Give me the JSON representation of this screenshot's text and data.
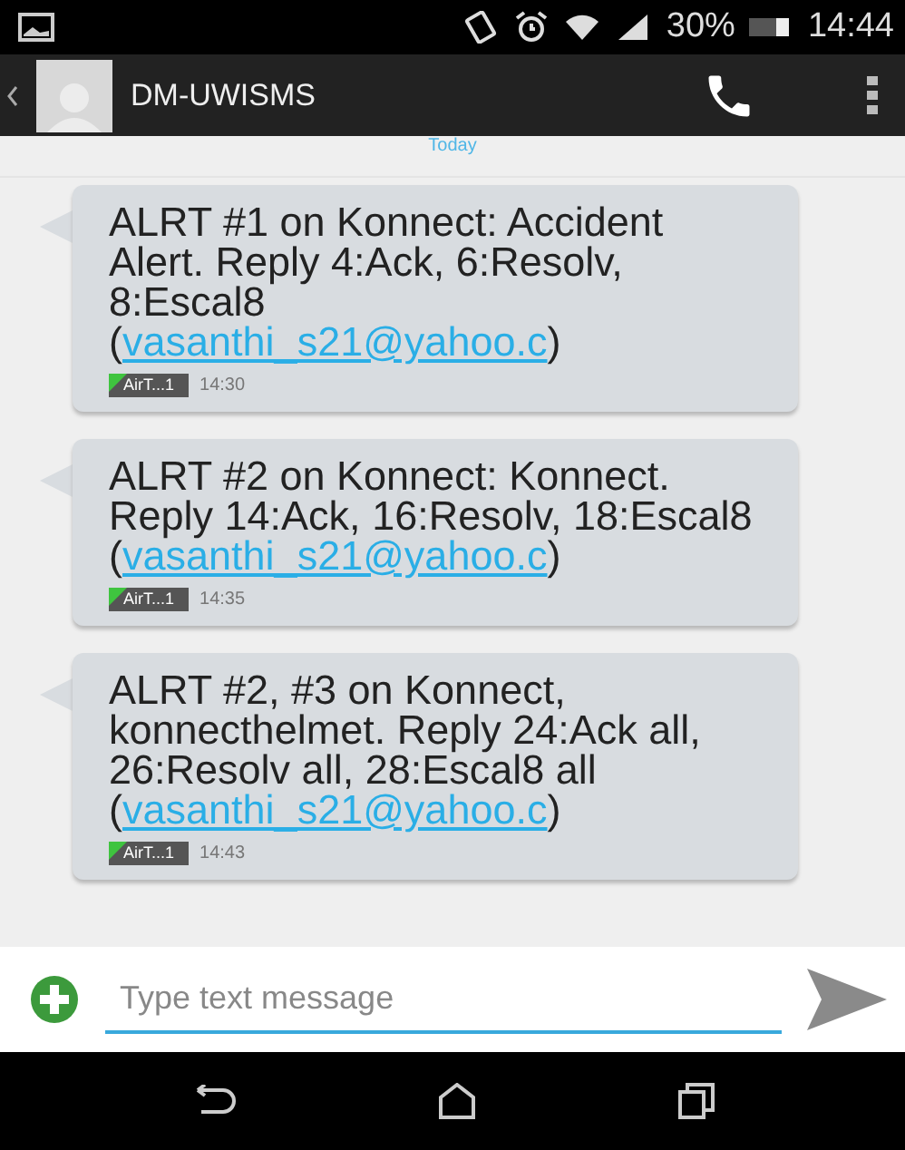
{
  "status_bar": {
    "battery": "30%",
    "time": "14:44"
  },
  "header": {
    "title": "DM-UWISMS"
  },
  "date_divider": "Today",
  "messages": [
    {
      "text": "ALRT #1 on Konnect: Accident Alert. Reply 4:Ack, 6:Resolv, 8:Escal8",
      "before_link": "(",
      "link": "vasanthi_s21@yahoo.c",
      "after_link": ")",
      "sim": "AirT...1",
      "time": "14:30"
    },
    {
      "text": "ALRT #2 on Konnect: Konnect. Reply 14:Ack, 16:Resolv, 18:Escal8",
      "before_link": "(",
      "link": "vasanthi_s21@yahoo.c",
      "after_link": ")",
      "sim": "AirT...1",
      "time": "14:35"
    },
    {
      "text": "ALRT #2, #3 on Konnect, konnecthelmet. Reply 24:Ack all, 26:Resolv all, 28:Escal8 all",
      "before_link": "(",
      "link": "vasanthi_s21@yahoo.c",
      "after_link": ")",
      "sim": "AirT...1",
      "time": "14:43"
    }
  ],
  "composer": {
    "placeholder": "Type text message"
  }
}
